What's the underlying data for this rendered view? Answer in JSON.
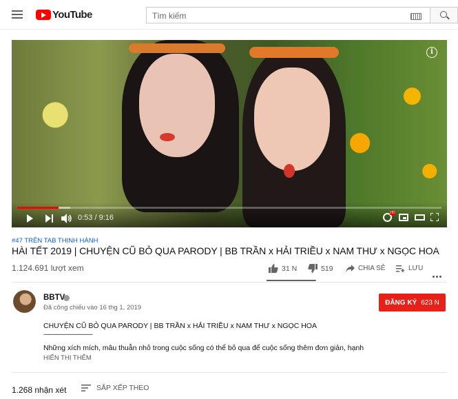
{
  "header": {
    "logo_text": "YouTube",
    "search_placeholder": "Tìm kiếm"
  },
  "player": {
    "current_time": "0:53",
    "duration": "9:16",
    "time_display": "0:53 / 9:16",
    "progress_fraction": 0.097,
    "buffered_fraction": 0.125,
    "info_symbol": "i",
    "settings_badge": "HD"
  },
  "video": {
    "trending_tag": "#47 TRÊN TAB THỊNH HÀNH",
    "title": "HÀI TẾT 2019 | CHUYỆN CŨ BỎ QUA PARODY | BB TRẦN x HẢI TRIỀU x NAM THƯ x NGỌC HOA",
    "views": "1.124.691 lượt xem",
    "likes": "31 N",
    "dislikes": "519",
    "share_label": "CHIA SẺ",
    "save_label": "LƯU",
    "like_ratio": 0.984
  },
  "channel": {
    "name": "BBTV",
    "published": "Đã công chiếu vào 16 thg 1, 2019",
    "subscribe_label": "ĐĂNG KÝ",
    "subscriber_count": "623 N"
  },
  "description": {
    "line1": "CHUYỆN CŨ BỎ QUA PARODY | BB TRẦN x HẢI TRIỀU x NAM THƯ x NGỌC HOA",
    "separator": "-----------------------------------------------",
    "line2": "Những xích mích, mâu thuẫn nhỏ trong cuộc sống có thể bỏ qua để cuộc sống thêm đơn giản, hạnh",
    "show_more": "HIỂN THỊ THÊM"
  },
  "comments": {
    "count_label": "1.268 nhận xét",
    "sort_label": "SẮP XẾP THEO"
  },
  "colors": {
    "brand_red": "#ff0000",
    "subscribe_red": "#e62117",
    "link_blue": "#065fd4"
  }
}
